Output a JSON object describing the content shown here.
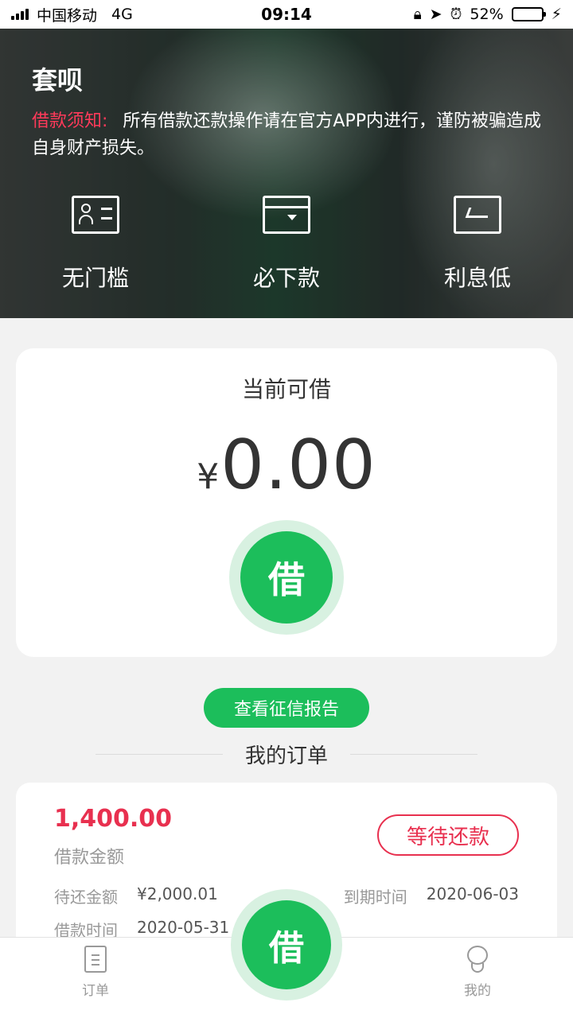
{
  "status_bar": {
    "carrier": "中国移动",
    "network": "4G",
    "time": "09:14",
    "battery_percent": "52%",
    "battery_level": 0.52
  },
  "header": {
    "app_title": "套呗",
    "notice_label": "借款须知:",
    "notice_text": "所有借款还款操作请在官方APP内进行，谨防被骗造成自身财产损失。",
    "features": [
      {
        "label": "无门槛",
        "icon": "id-card-icon"
      },
      {
        "label": "必下款",
        "icon": "bank-card-icon"
      },
      {
        "label": "利息低",
        "icon": "low-rate-icon"
      }
    ]
  },
  "loan_card": {
    "available_label": "当前可借",
    "currency": "¥",
    "amount": "0.00",
    "borrow_label": "借"
  },
  "credit_report_label": "查看征信报告",
  "orders": {
    "title": "我的订单",
    "items": [
      {
        "amount": "1,400.00",
        "amount_label": "借款金额",
        "status": "等待还款",
        "repay_label": "待还金额",
        "repay_value": "¥2,000.01",
        "due_label": "到期时间",
        "due_value": "2020-06-03",
        "loan_time_label": "借款时间",
        "loan_time_value": "2020-05-31"
      }
    ]
  },
  "tab_bar": {
    "orders_label": "订单",
    "center_label": "借",
    "me_label": "我的"
  },
  "colors": {
    "accent_green": "#1cbe5b",
    "alert_red": "#e8304f"
  }
}
